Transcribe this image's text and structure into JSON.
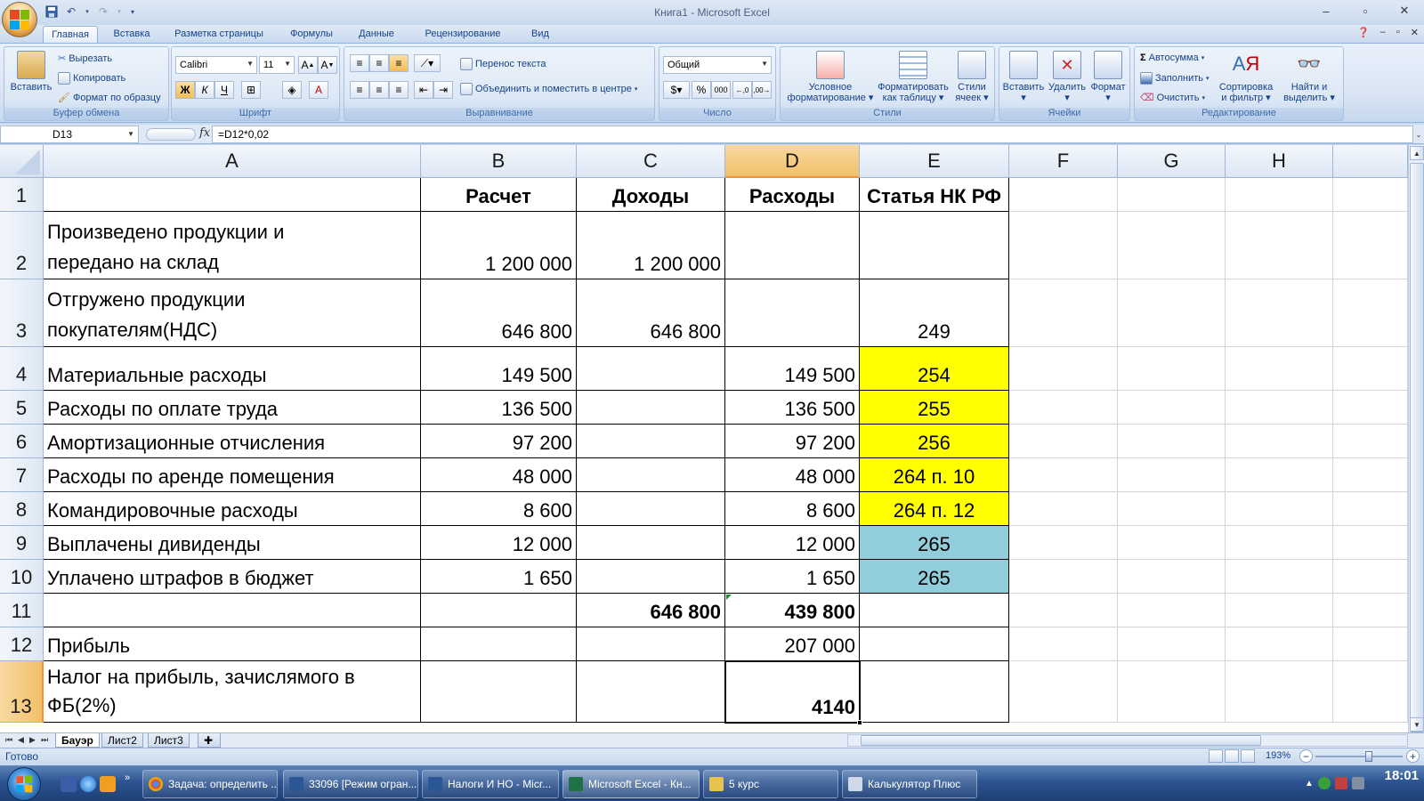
{
  "window": {
    "title": "Книга1 - Microsoft Excel"
  },
  "ribbon_tabs": [
    "Главная",
    "Вставка",
    "Разметка страницы",
    "Формулы",
    "Данные",
    "Рецензирование",
    "Вид"
  ],
  "ribbon": {
    "clipboard": {
      "label": "Буфер обмена",
      "paste": "Вставить",
      "cut": "Вырезать",
      "copy": "Копировать",
      "format_painter": "Формат по образцу"
    },
    "font": {
      "label": "Шрифт",
      "font_name": "Calibri",
      "font_size": "11"
    },
    "alignment": {
      "label": "Выравнивание",
      "wrap_text": "Перенос текста",
      "merge_center": "Объединить и поместить в центре"
    },
    "number": {
      "label": "Число",
      "format": "Общий",
      "percent": "%",
      "thousands": "000"
    },
    "styles": {
      "label": "Стили",
      "conditional_1": "Условное",
      "conditional_2": "форматирование",
      "as_table_1": "Форматировать",
      "as_table_2": "как таблицу",
      "cell_styles_1": "Стили",
      "cell_styles_2": "ячеек"
    },
    "cells": {
      "label": "Ячейки",
      "insert": "Вставить",
      "delete": "Удалить",
      "format": "Формат"
    },
    "editing": {
      "label": "Редактирование",
      "autosum": "Автосумма",
      "fill": "Заполнить",
      "clear": "Очистить",
      "sort_1": "Сортировка",
      "sort_2": "и фильтр",
      "find_1": "Найти и",
      "find_2": "выделить"
    }
  },
  "formula_bar": {
    "name_box": "D13",
    "fx": "fx",
    "formula": "=D12*0,02"
  },
  "columns": [
    "A",
    "B",
    "C",
    "D",
    "E",
    "F",
    "G",
    "H"
  ],
  "selected_column": "D",
  "selected_row": "13",
  "rows": [
    {
      "num": "1",
      "a": "",
      "b": "Расчет",
      "c": "Доходы",
      "d": "Расходы",
      "e": "Статья НК РФ"
    },
    {
      "num": "2",
      "a1": "Произведено продукции и",
      "a2": "передано на склад",
      "b": "1 200 000",
      "c": "1 200 000",
      "d": "",
      "e": ""
    },
    {
      "num": "3",
      "a1": "Отгружено продукции",
      "a2": "покупателям(НДС)",
      "b": "646 800",
      "c": "646 800",
      "d": "",
      "e": "249"
    },
    {
      "num": "4",
      "a": "Материальные расходы",
      "b": "149 500",
      "c": "",
      "d": "149 500",
      "e": "254"
    },
    {
      "num": "5",
      "a": "Расходы по оплате труда",
      "b": "136 500",
      "c": "",
      "d": "136 500",
      "e": "255"
    },
    {
      "num": "6",
      "a": "Амортизационные отчисления",
      "b": "97 200",
      "c": "",
      "d": "97 200",
      "e": "256"
    },
    {
      "num": "7",
      "a": "Расходы по аренде помещения",
      "b": "48 000",
      "c": "",
      "d": "48 000",
      "e": "264 п. 10"
    },
    {
      "num": "8",
      "a": "Командировочные расходы",
      "b": "8 600",
      "c": "",
      "d": "8 600",
      "e": "264 п. 12"
    },
    {
      "num": "9",
      "a": "Выплачены дивиденды",
      "b": "12 000",
      "c": "",
      "d": "12 000",
      "e": "265"
    },
    {
      "num": "10",
      "a": "Уплачено штрафов в бюджет",
      "b": "1 650",
      "c": "",
      "d": "1 650",
      "e": "265"
    },
    {
      "num": "11",
      "a": "",
      "b": "",
      "c": "646 800",
      "d": "439 800",
      "e": ""
    },
    {
      "num": "12",
      "a": "Прибыль",
      "b": "",
      "c": "",
      "d": "207 000",
      "e": ""
    },
    {
      "num": "13",
      "a1": "Налог на прибыль, зачислямого в",
      "a2": "ФБ(2%)",
      "b": "",
      "c": "",
      "d": "4140",
      "e": ""
    }
  ],
  "sheet_tabs": [
    "Бауэр",
    "Лист2",
    "Лист3"
  ],
  "active_sheet": "Бауэр",
  "status": {
    "ready": "Готово",
    "zoom": "193%"
  },
  "taskbar": {
    "items": [
      "Задача: определить ...",
      "33096 [Режим огран...",
      "Налоги И НО - Micr...",
      "Microsoft Excel - Кн...",
      "5 курс",
      "Калькулятор Плюс"
    ],
    "active_item": "Microsoft Excel - Кн...",
    "clock": "18:01"
  },
  "colors": {
    "yellow_fill": "#ffff00",
    "blue_fill": "#92cddc",
    "selection_header": "#f1c06a"
  }
}
